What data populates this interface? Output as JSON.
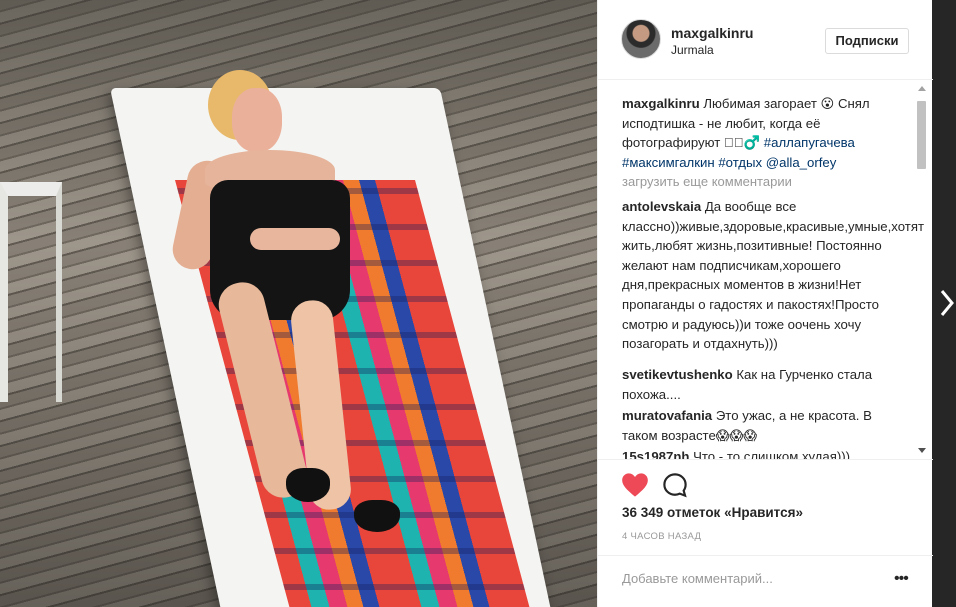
{
  "post": {
    "username": "maxgalkinru",
    "location": "Jurmala",
    "follow_label": "Подписки",
    "caption": {
      "author": "maxgalkinru",
      "text": "Любимая загорает 😮 Снял исподтишка - не любит, когда её фотографируют 🏻🏻♂️",
      "tags": [
        "#аллапугачева",
        "#максимгалкин",
        "#отдых",
        "@alla_orfey"
      ]
    },
    "load_more_label": "загрузить еще комментарии",
    "comments": [
      {
        "author": "antolevskaia",
        "text": "Да вообще все классно))живые,здоровые,красивые,умные,хотят жить,любят жизнь,позитивные! Постоянно желают нам подписчикам,хорошего дня,прекрасных моментов в жизни!Нет пропаганды о гадостях и пакостях!Просто смотрю и радуюсь))и тоже оочень хочу позагорать и отдахнуть)))"
      },
      {
        "author": "svetikevtushenko",
        "text": "Как на Гурченко стала похожа...."
      },
      {
        "author": "muratovafania",
        "text": "Это ужас, а не красота. В таком возрасте😱😱😱"
      },
      {
        "author": "15s1987nh",
        "text": "Что - то слишком худая)))"
      }
    ],
    "likes_text": "36 349 отметок «Нравится»",
    "time_ago": "4 ЧАСОВ НАЗАД",
    "add_comment_placeholder": "Добавьте комментарий...",
    "more_glyph": "•••"
  },
  "colors": {
    "heart": "#ed4956",
    "link": "#003569",
    "muted": "#999999"
  },
  "icons": {
    "like": "heart-icon",
    "comment": "comment-icon",
    "next": "chevron-right-icon",
    "more": "more-options-icon"
  }
}
